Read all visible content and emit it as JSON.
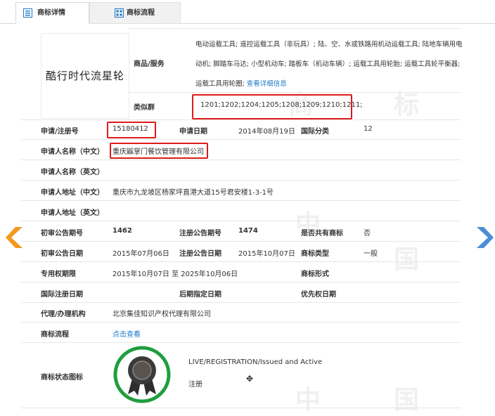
{
  "tabs": {
    "detail": "商标详情",
    "flow": "商标流程"
  },
  "logo_text": "酷行时代流星轮",
  "goods": {
    "label": "商品/服务",
    "text": "电动运载工具; 遥控运载工具（非玩具）; 陆、空、水或铁路用机动运载工具; 陆地车辆用电动机; 脚踏车马达; 小型机动车; 踏板车（机动车辆）; 运载工具用轮胎; 运载工具轮平衡器; 运载工具用轮圈; ",
    "link": "查看详细信息"
  },
  "similar": {
    "label": "类似群",
    "value": "1201;1202;1204;1205;1208;1209;1210;1211;"
  },
  "reg": {
    "label": "申请/注册号",
    "value": "15180412",
    "date_label": "申请日期",
    "date": "2014年08月19日",
    "class_label": "国际分类",
    "class": "12"
  },
  "applicant_cn": {
    "label": "申请人名称（中文）",
    "value": "重庆鼷掌门餐饮管理有限公司"
  },
  "applicant_en": {
    "label": "申请人名称（英文）",
    "value": ""
  },
  "address_cn": {
    "label": "申请人地址（中文）",
    "value": "重庆市九龙坡区杨家坪直港大道15号君安楼1-3-1号"
  },
  "address_en": {
    "label": "申请人地址（英文）",
    "value": ""
  },
  "pub1": {
    "l1": "初审公告期号",
    "v1": "1462",
    "l2": "注册公告期号",
    "v2": "1474",
    "l3": "是否共有商标",
    "v3": "否"
  },
  "pub2": {
    "l1": "初审公告日期",
    "v1": "2015年07月06日",
    "l2": "注册公告日期",
    "v2": "2015年10月07日",
    "l3": "商标类型",
    "v3": "一般"
  },
  "term": {
    "l1": "专用权期限",
    "v1": "2015年10月07日 至 2025年10月06日",
    "l3": "商标形式",
    "v3": ""
  },
  "intl": {
    "l1": "国际注册日期",
    "l2": "后期指定日期",
    "l3": "优先权日期"
  },
  "agent": {
    "label": "代理/办理机构",
    "value": "北京集佳知识产权代理有限公司"
  },
  "flow": {
    "label": "商标流程",
    "link": "点击查看"
  },
  "status": {
    "label": "商标状态图标",
    "line1": "LIVE/REGISTRATION/Issued and Active",
    "line2": "注册"
  },
  "colors": {
    "accent": "#1a79c9",
    "highlight": "#e01a1a",
    "prev_arrow": "#f39a1e",
    "next_arrow": "#4a8fd6",
    "badge": "#1f9e3d"
  },
  "icons": {
    "prev": "chevron-left-icon",
    "next": "chevron-right-icon",
    "tab_detail": "list-icon",
    "tab_flow": "grid-icon",
    "status": "award-badge-icon",
    "cursor": "move-cursor-icon"
  }
}
